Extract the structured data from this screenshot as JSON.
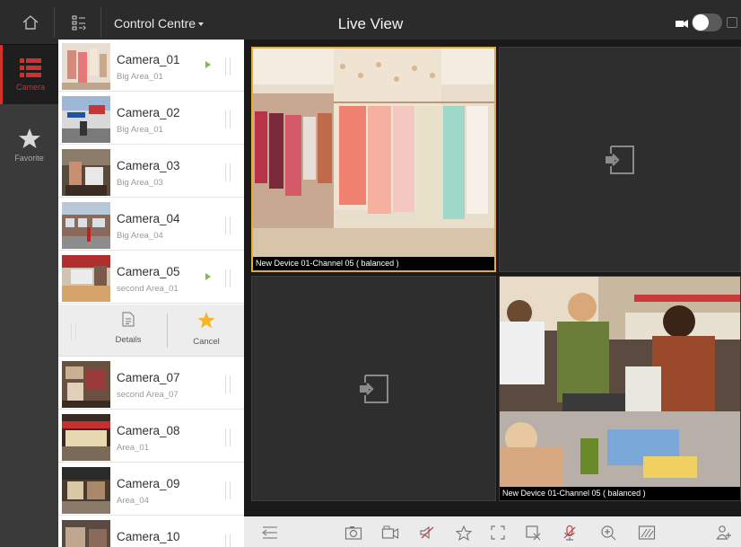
{
  "topbar": {
    "control_centre": "Control Centre",
    "title": "Live View"
  },
  "rail": {
    "camera_label": "Camera",
    "favorite_label": "Favorite",
    "accent_color": "#d0302e"
  },
  "cameras": [
    {
      "name": "Camera_01",
      "area": "Big Area_01",
      "playing": true
    },
    {
      "name": "Camera_02",
      "area": "Big Area_01",
      "playing": false
    },
    {
      "name": "Camera_03",
      "area": "Big Area_03",
      "playing": false
    },
    {
      "name": "Camera_04",
      "area": "Big Area_04",
      "playing": false
    },
    {
      "name": "Camera_05",
      "area": "second Area_01",
      "playing": true
    },
    {
      "name": "Camera_07",
      "area": "second Area_07",
      "playing": false
    },
    {
      "name": "Camera_08",
      "area": "Area_01",
      "playing": false
    },
    {
      "name": "Camera_09",
      "area": "Area_04",
      "playing": false
    },
    {
      "name": "Camera_10",
      "area": "",
      "playing": false
    }
  ],
  "row_actions": {
    "details": "Details",
    "cancel": "Cancel"
  },
  "panes": [
    {
      "caption": "New Device 01-Channel 05 ( balanced )",
      "state": "live",
      "selected": true
    },
    {
      "caption": "",
      "state": "empty",
      "selected": false
    },
    {
      "caption": "",
      "state": "empty",
      "selected": false
    },
    {
      "caption": "New Device 01-Channel 05 ( balanced )",
      "state": "live",
      "selected": false
    }
  ],
  "toolbar_icons": [
    "collapse-icon",
    "capture-icon",
    "record-icon",
    "mute-icon",
    "favorite-icon",
    "fullscreen-icon",
    "close-pane-icon",
    "microphone-icon",
    "zoom-icon",
    "quality-icon",
    "ptz-icon"
  ]
}
